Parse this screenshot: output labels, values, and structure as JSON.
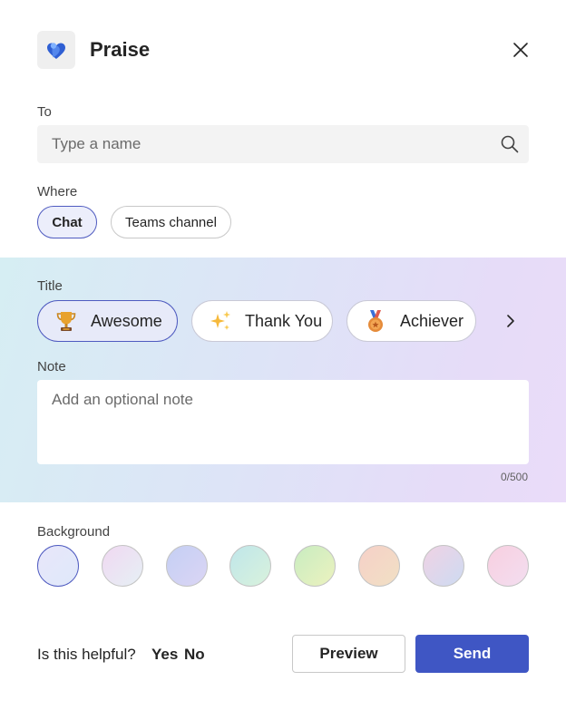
{
  "header": {
    "title": "Praise",
    "app_icon": "praise-app-icon",
    "close_icon": "close-icon"
  },
  "to": {
    "label": "To",
    "placeholder": "Type a name",
    "value": ""
  },
  "where": {
    "label": "Where",
    "options": [
      {
        "label": "Chat",
        "selected": true
      },
      {
        "label": "Teams channel",
        "selected": false
      }
    ]
  },
  "title_section": {
    "label": "Title",
    "options": [
      {
        "label": "Awesome",
        "icon": "trophy-icon",
        "selected": true
      },
      {
        "label": "Thank You",
        "icon": "sparkles-icon",
        "selected": false
      },
      {
        "label": "Achiever",
        "icon": "medal-icon",
        "selected": false
      }
    ],
    "next_icon": "chevron-right-icon"
  },
  "note": {
    "label": "Note",
    "placeholder": "Add an optional note",
    "counter": "0/500"
  },
  "background": {
    "label": "Background",
    "swatches": [
      {
        "colors": [
          "#e8e6fb",
          "#dfe9f9"
        ],
        "selected": true
      },
      {
        "colors": [
          "#f0d8f2",
          "#e6f0f4"
        ],
        "selected": false
      },
      {
        "colors": [
          "#c4cff3",
          "#dbd5f5"
        ],
        "selected": false
      },
      {
        "colors": [
          "#bfe6ea",
          "#d9f2dc"
        ],
        "selected": false
      },
      {
        "colors": [
          "#c8ecc0",
          "#ecf2bf"
        ],
        "selected": false
      },
      {
        "colors": [
          "#f6d0c8",
          "#f1e0c4"
        ],
        "selected": false
      },
      {
        "colors": [
          "#f0d2e4",
          "#cddbf2"
        ],
        "selected": false
      },
      {
        "colors": [
          "#f8cfe0",
          "#f3def0"
        ],
        "selected": false
      }
    ]
  },
  "footer": {
    "helpful_text": "Is this helpful?",
    "yes": "Yes",
    "no": "No",
    "preview_label": "Preview",
    "send_label": "Send",
    "accent": "#3f56c4"
  }
}
